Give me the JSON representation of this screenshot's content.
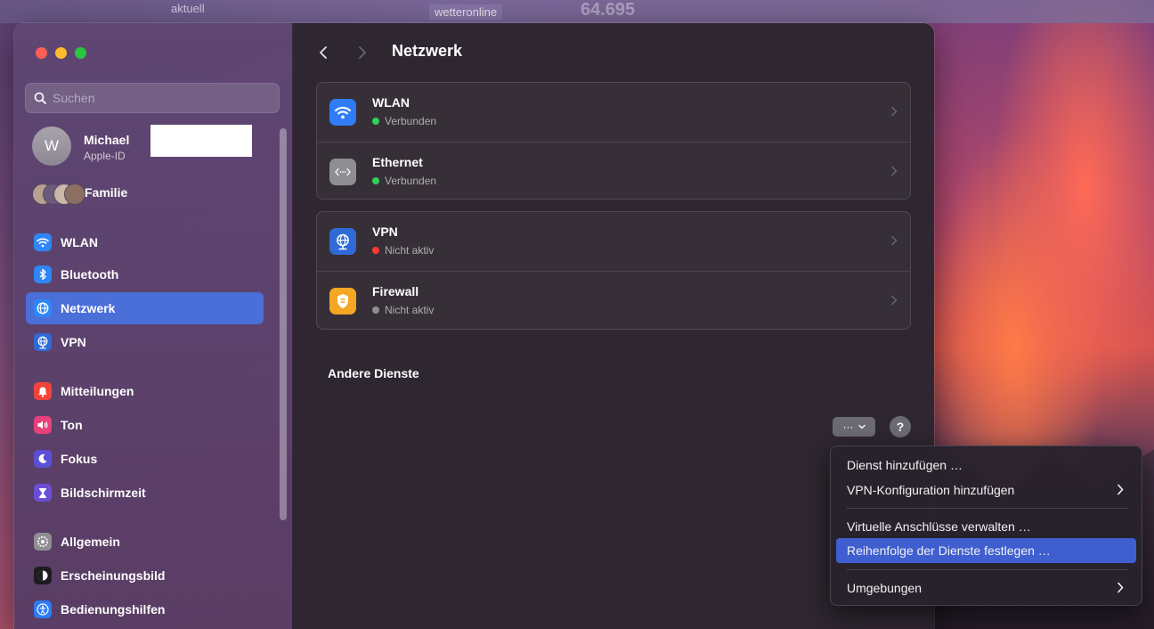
{
  "desktop": {
    "top_left_text": "aktuell",
    "top_mid_text": "wetteronline",
    "top_number": "64.695"
  },
  "search": {
    "placeholder": "Suchen"
  },
  "account": {
    "initial": "W",
    "name": "Michael",
    "subtitle": "Apple-ID"
  },
  "family": {
    "label": "Familie"
  },
  "sidebar": {
    "items": [
      {
        "label": "WLAN",
        "icon": "wifi-icon",
        "color": "#2f86f6"
      },
      {
        "label": "Bluetooth",
        "icon": "bluetooth-icon",
        "color": "#2f86f6"
      },
      {
        "label": "Netzwerk",
        "icon": "globe-icon",
        "color": "#2f86f6",
        "active": true
      },
      {
        "label": "VPN",
        "icon": "vpn-globe-icon",
        "color": "#2f6ad6"
      },
      {
        "label": "Mitteilungen",
        "icon": "bell-icon",
        "color": "#f0443a"
      },
      {
        "label": "Ton",
        "icon": "speaker-icon",
        "color": "#e8407a"
      },
      {
        "label": "Fokus",
        "icon": "moon-icon",
        "color": "#5b4fd6"
      },
      {
        "label": "Bildschirmzeit",
        "icon": "hourglass-icon",
        "color": "#6a4fd6"
      },
      {
        "label": "Allgemein",
        "icon": "gear-icon",
        "color": "#8e8e93"
      },
      {
        "label": "Erscheinungsbild",
        "icon": "appearance-icon",
        "color": "#1c1c1e"
      },
      {
        "label": "Bedienungshilfen",
        "icon": "accessibility-icon",
        "color": "#2f7cf6"
      }
    ]
  },
  "main": {
    "title": "Netzwerk",
    "group1": [
      {
        "title": "WLAN",
        "status": "Verbunden",
        "status_color": "#30d158",
        "icon": "wifi-icon",
        "icon_color": "#2f7cf6"
      },
      {
        "title": "Ethernet",
        "status": "Verbunden",
        "status_color": "#30d158",
        "icon": "ethernet-icon",
        "icon_color": "#8e8e93"
      }
    ],
    "group2": [
      {
        "title": "VPN",
        "status": "Nicht aktiv",
        "status_color": "#ff3b30",
        "icon": "vpn-globe-icon",
        "icon_color": "#2f6ad6"
      },
      {
        "title": "Firewall",
        "status": "Nicht aktiv",
        "status_color": "#8e8e93",
        "icon": "firewall-icon",
        "icon_color": "#f5a623"
      }
    ],
    "section_other": "Andere Dienste",
    "more_button_label": "···",
    "help_button_label": "?"
  },
  "menu": {
    "items": [
      {
        "label": "Dienst hinzufügen …",
        "submenu": false
      },
      {
        "label": "VPN-Konfiguration hinzufügen",
        "submenu": true
      },
      {
        "label": "Virtuelle Anschlüsse verwalten …",
        "submenu": false
      },
      {
        "label": "Reihenfolge der Dienste festlegen …",
        "submenu": false,
        "highlighted": true
      },
      {
        "label": "Umgebungen",
        "submenu": true
      }
    ]
  }
}
